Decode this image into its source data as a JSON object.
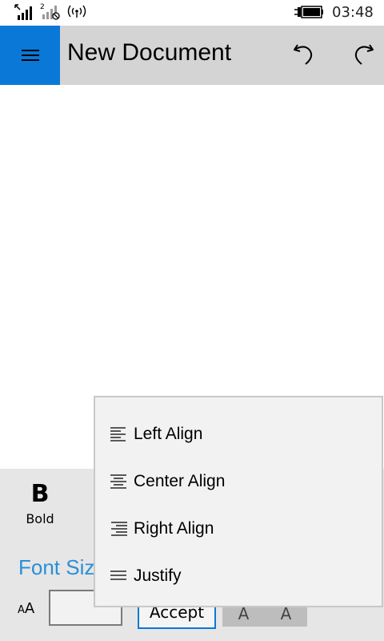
{
  "status_bar": {
    "time": "03:48",
    "sim2_label": "2"
  },
  "header": {
    "title": "New Document",
    "accent": "#0a78d7"
  },
  "toolbar": {
    "bold_glyph": "B",
    "bold_label": "Bold",
    "font_size_label": "Font Siz",
    "font_size_value": "",
    "aa_glyph_big": "A",
    "aa_glyph_small": "A",
    "accept_label": "Accept",
    "a_button_1": "A",
    "a_button_2": "A"
  },
  "align_menu": {
    "items": [
      {
        "label": "Left Align",
        "icon": "align-left-icon"
      },
      {
        "label": "Center Align",
        "icon": "align-center-icon"
      },
      {
        "label": "Right Align",
        "icon": "align-right-icon"
      },
      {
        "label": "Justify",
        "icon": "justify-icon"
      }
    ]
  }
}
